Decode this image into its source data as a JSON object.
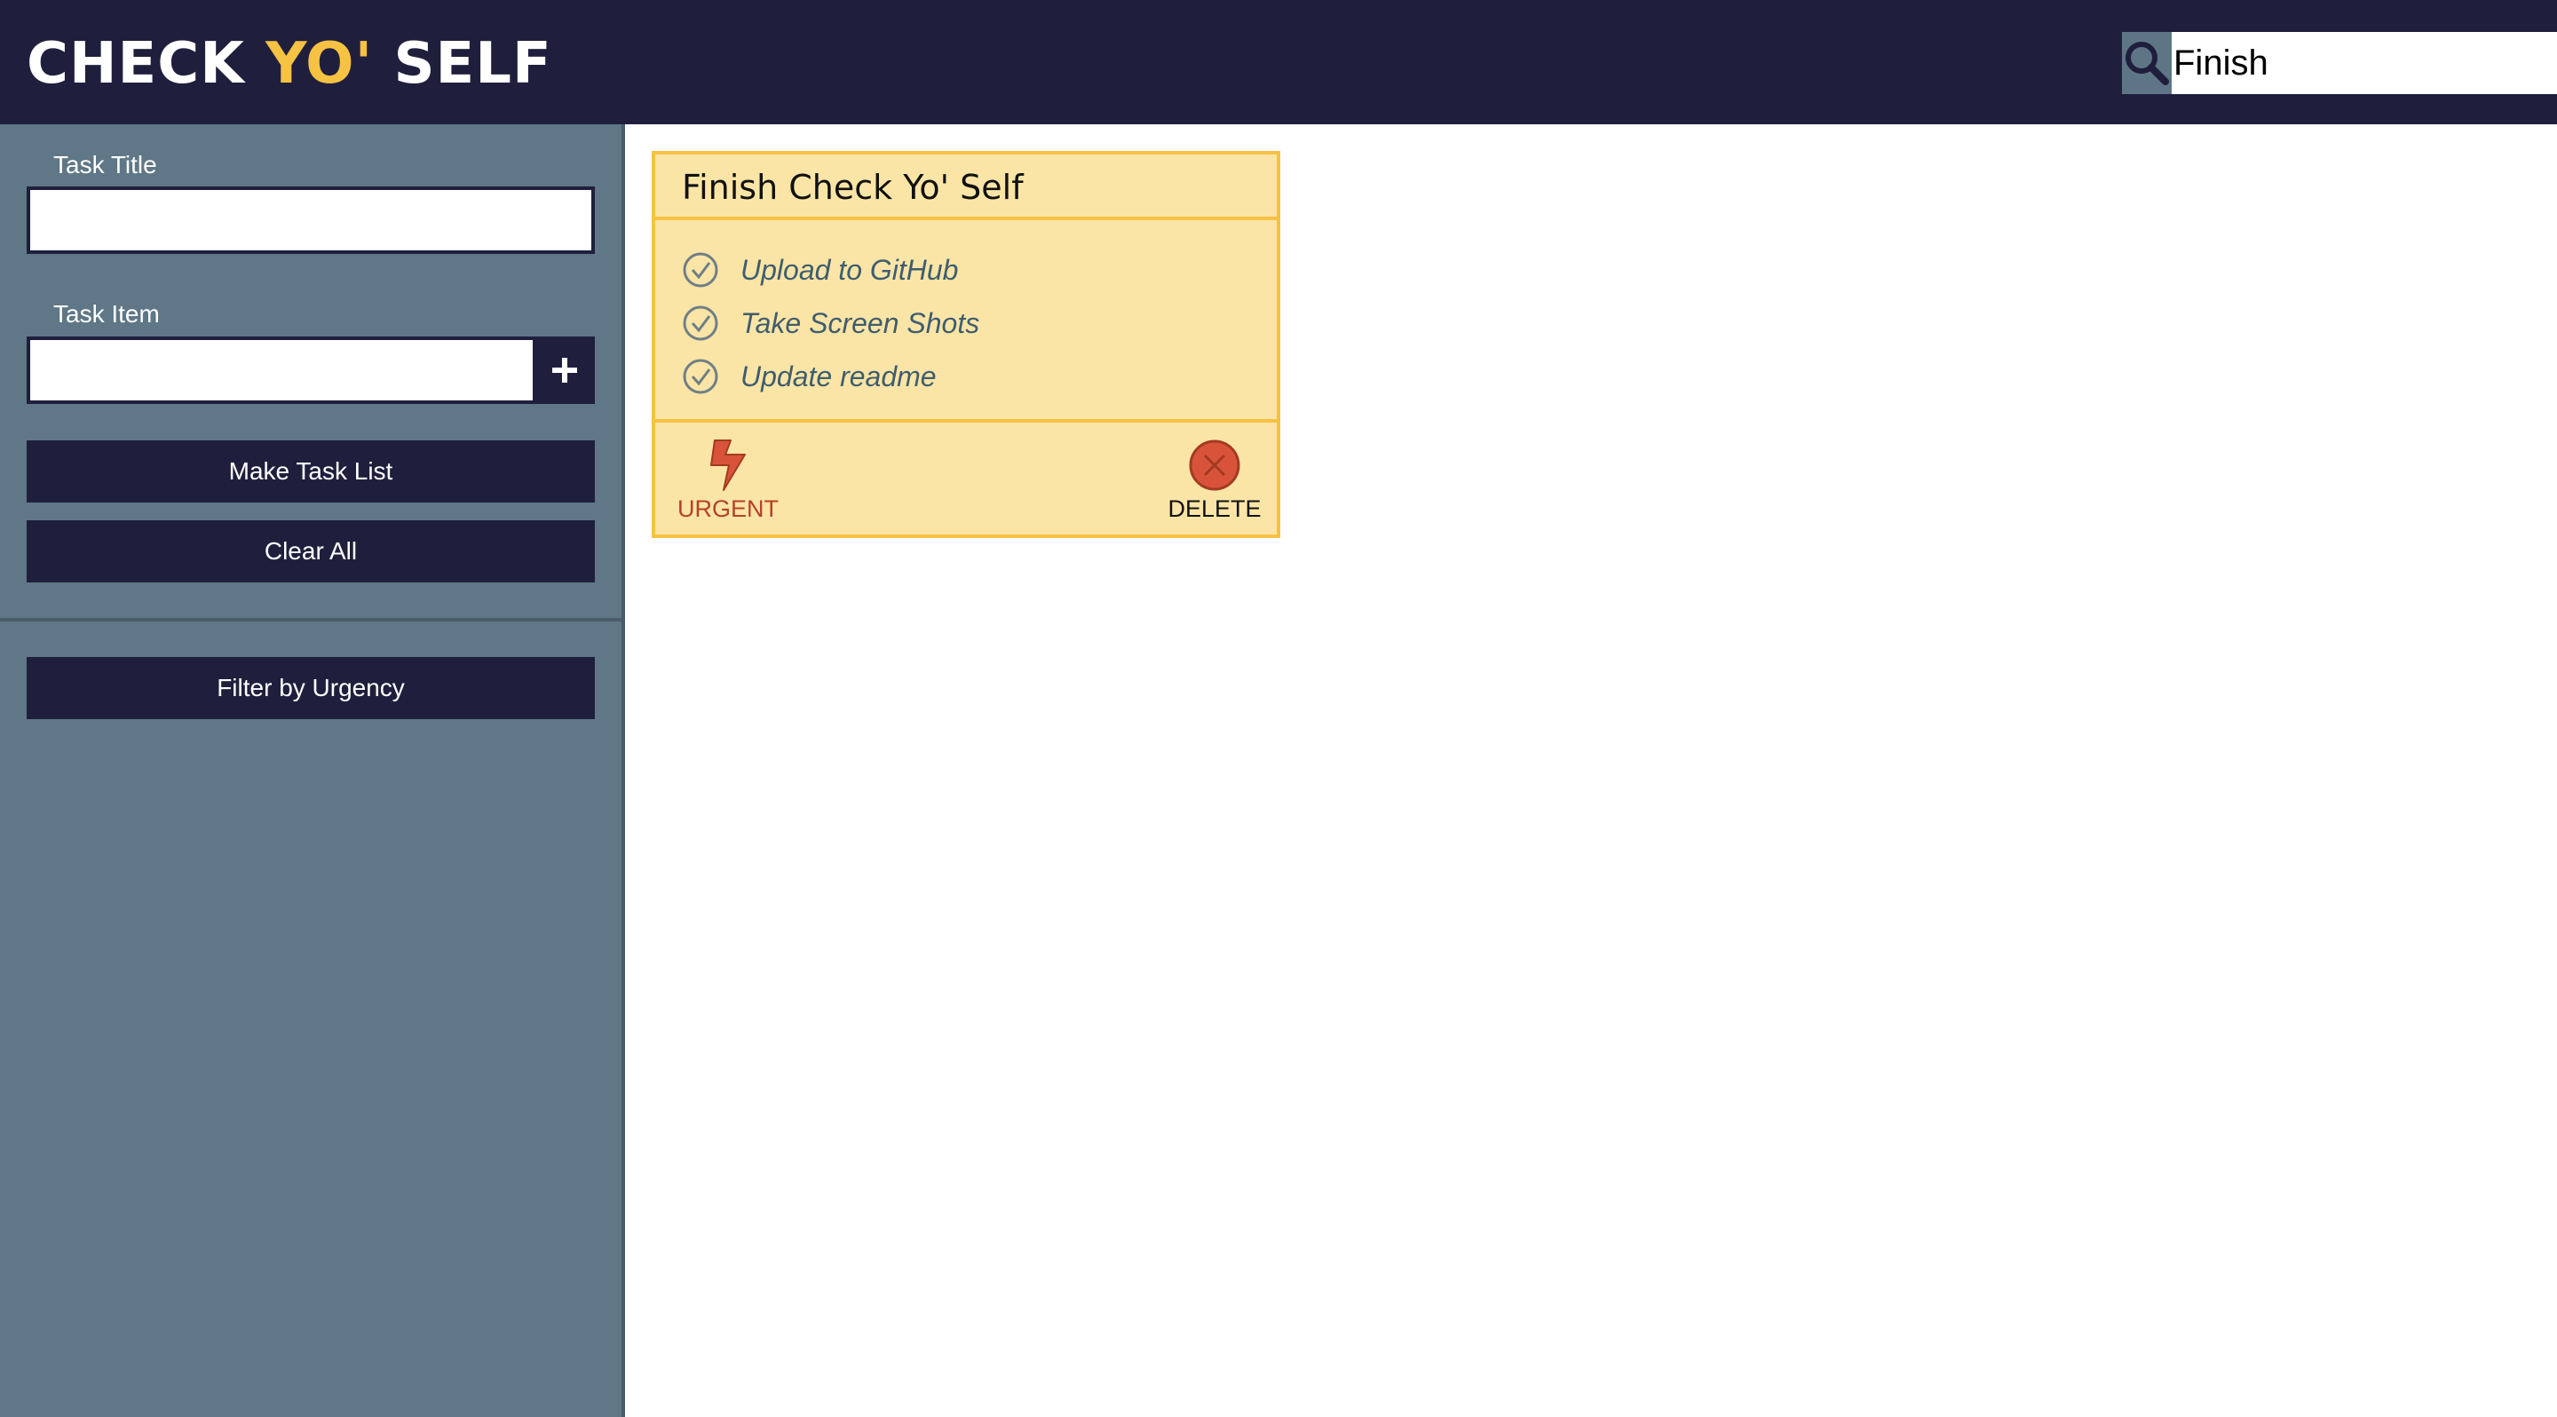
{
  "header": {
    "logo_part1": "CHECK ",
    "logo_accent": "YO'",
    "logo_part2": " SELF",
    "search_value": "Finish",
    "search_icon": "magnifier-icon"
  },
  "sidebar": {
    "task_title_label": "Task Title",
    "task_title_value": "",
    "task_item_label": "Task Item",
    "task_item_value": "",
    "add_icon": "plus-icon",
    "make_list_label": "Make Task List",
    "clear_all_label": "Clear All",
    "filter_label": "Filter by Urgency"
  },
  "card": {
    "title": "Finish Check Yo' Self",
    "items": [
      {
        "text": "Upload to GitHub",
        "icon": "check-circle-icon"
      },
      {
        "text": "Take Screen Shots",
        "icon": "check-circle-icon"
      },
      {
        "text": "Update readme",
        "icon": "check-circle-icon"
      }
    ],
    "urgent_label": "URGENT",
    "urgent_icon": "lightning-bolt-icon",
    "delete_label": "DELETE",
    "delete_icon": "delete-circle-icon"
  },
  "colors": {
    "navy": "#1f1f3d",
    "accent_yellow": "#f6c244",
    "sidebar": "#5f7786",
    "card_bg": "#fbe5a6",
    "urgent_red": "#b5412a",
    "delete_red": "#d9533a"
  }
}
